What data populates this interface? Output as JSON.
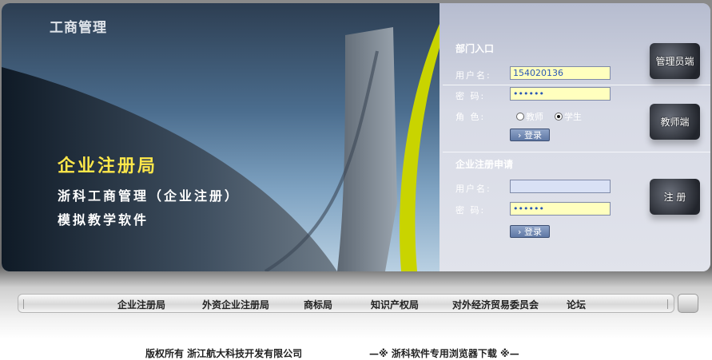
{
  "header": {
    "brand": "工商管理"
  },
  "banner": {
    "title": "企业注册局",
    "subtitle_line1": "浙科工商管理（企业注册）",
    "subtitle_line2": "模拟教学软件"
  },
  "department_login": {
    "title": "部门入口",
    "username_label": "用户名:",
    "username_value": "154020136",
    "password_label": "密  码:",
    "password_value": "••••••",
    "role_label": "角  色:",
    "role_options": [
      "教师",
      "学生"
    ],
    "selected_role": "学生",
    "login_button": "登录"
  },
  "company_register": {
    "title": "企业注册申请",
    "username_label": "用户名:",
    "username_value": "",
    "password_label": "密  码:",
    "password_value": "••••••",
    "login_button": "登录"
  },
  "role_tiles": {
    "admin": "管理员端",
    "teacher": "教师端",
    "register": "注  册"
  },
  "nav": {
    "items": [
      "企业注册局",
      "外资企业注册局",
      "商标局",
      "知识产权局",
      "对外经济贸易委员会",
      "论坛"
    ]
  },
  "footer": {
    "copyright": "版权所有  浙江航大科技开发有限公司",
    "download": "—※  浙科软件专用浏览器下载  ※—"
  },
  "colors": {
    "accent_yellow": "#ffe84a",
    "input_yellow": "#ffffbe",
    "input_blue": "#d9e1f5",
    "curve_yellow": "#c9d400"
  }
}
